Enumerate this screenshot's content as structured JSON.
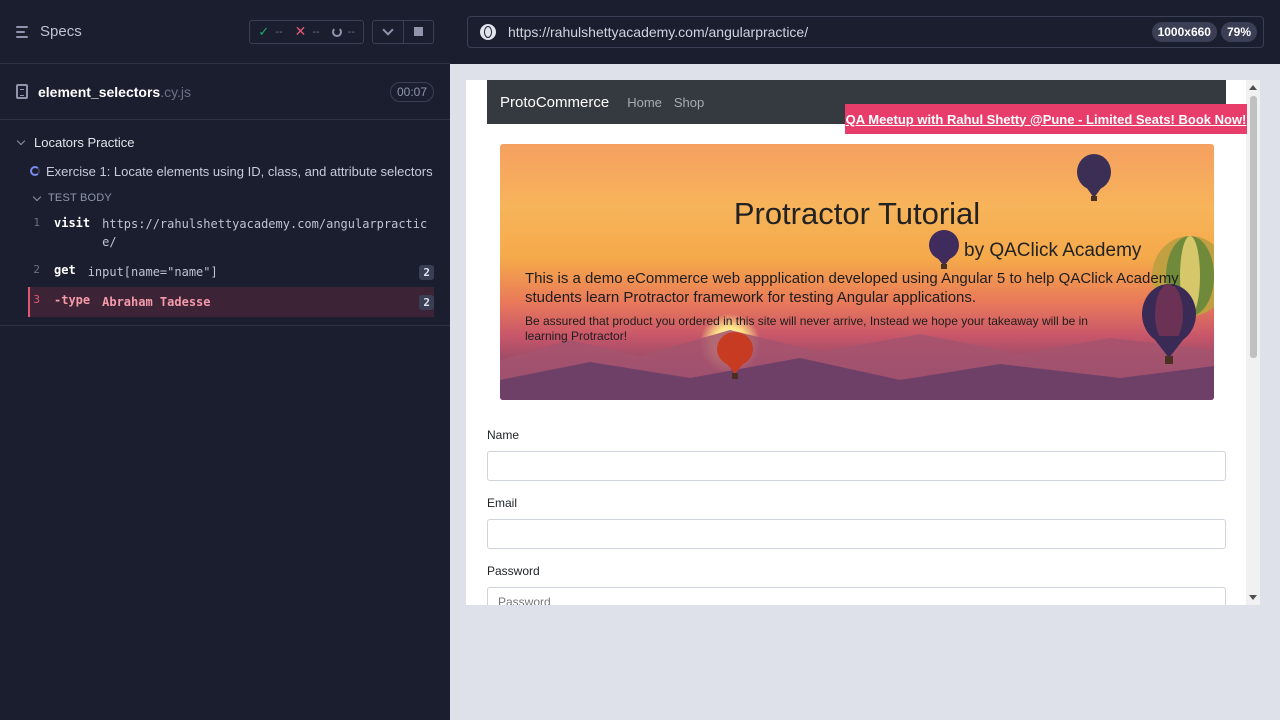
{
  "reporter": {
    "specs_label": "Specs",
    "stats": {
      "passed": "--",
      "failed": "--",
      "pending": "--"
    },
    "file": {
      "name": "element_selectors",
      "ext": ".cy.js",
      "duration": "00:07"
    },
    "suite_title": "Locators Practice",
    "test_title": "Exercise 1: Locate elements using ID, class, and attribute selectors",
    "test_body_label": "TEST BODY",
    "commands": [
      {
        "num": "1",
        "name": "visit",
        "message": "https://rahulshettyacademy.com/angularpractice/",
        "count": ""
      },
      {
        "num": "2",
        "name": "get",
        "message": "input[name=\"name\"]",
        "count": "2"
      },
      {
        "num": "3",
        "name": "-type",
        "message": "Abraham Tadesse",
        "count": "2"
      }
    ]
  },
  "aut": {
    "url": "https://rahulshettyacademy.com/angularpractice/",
    "viewport_size": "1000x660",
    "zoom": "79%",
    "page": {
      "brand": "ProtoCommerce",
      "nav": [
        "Home",
        "Shop"
      ],
      "promo": "QA Meetup with Rahul Shetty @Pune - Limited Seats! Book Now!",
      "hero": {
        "title": "Protractor Tutorial",
        "subtitle": "by QAClick Academy",
        "p1": "This is a demo eCommerce web appplication developed using Angular 5 to help QAClick Academy students learn Protractor framework for testing Angular applications.",
        "p2": "Be assured that product you ordered in this site will never arrive, Instead we hope your takeaway will be in learning Protractor!"
      },
      "form": {
        "name_label": "Name",
        "email_label": "Email",
        "password_label": "Password",
        "password_placeholder": "Password"
      }
    }
  }
}
